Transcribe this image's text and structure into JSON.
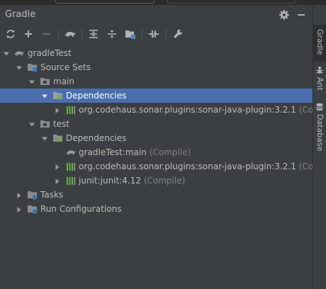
{
  "panel": {
    "title": "Gradle"
  },
  "icons": {
    "settings": "gear-icon",
    "minimize": "minimize-icon",
    "refresh": "refresh-icon",
    "add": "plus-icon",
    "remove": "minus-icon",
    "execute": "elephant-icon",
    "expand_all": "expand-all-icon",
    "collapse_all": "collapse-all-icon",
    "group_modules": "folder-group-icon",
    "offline": "offline-mode-icon",
    "build_settings": "wrench-icon"
  },
  "tree": {
    "root": "gradleTest",
    "source_sets": "Source Sets",
    "main": "main",
    "main_deps": "Dependencies",
    "main_dep1": "org.codehaus.sonar.plugins:sonar-java-plugin:3.2.1",
    "main_dep1_scope": "(Comp",
    "test": "test",
    "test_deps": "Dependencies",
    "test_dep1": "gradleTest:main",
    "test_dep1_scope": "(Compile)",
    "test_dep2": "org.codehaus.sonar.plugins:sonar-java-plugin:3.2.1",
    "test_dep2_scope": "(Com",
    "test_dep3": "junit:junit:4.12",
    "test_dep3_scope": "(Compile)",
    "tasks": "Tasks",
    "run_configs": "Run Configurations"
  },
  "side_tabs": {
    "gradle": "Gradle",
    "ant": "Ant",
    "database": "Database"
  },
  "colors": {
    "background": "#3c3f41",
    "selection": "#4b6eaf",
    "text": "#bbbbbb",
    "scope_text": "#808080",
    "library_green": "#62b543"
  }
}
